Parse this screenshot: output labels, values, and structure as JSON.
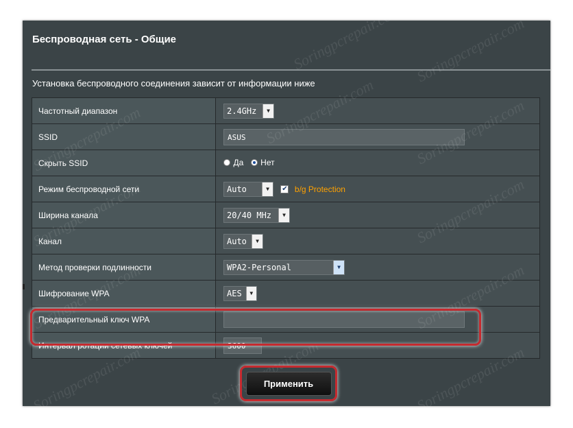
{
  "page": {
    "title": "Беспроводная сеть - Общие",
    "description": "Установка беспроводного соединения зависит от информации ниже"
  },
  "rows": {
    "band": {
      "label": "Частотный диапазон",
      "value": "2.4GHz"
    },
    "ssid": {
      "label": "SSID",
      "value": "ASUS"
    },
    "hide_ssid": {
      "label": "Скрыть SSID",
      "option_yes": "Да",
      "option_no": "Нет",
      "selected": "Нет"
    },
    "mode": {
      "label": "Режим беспроводной сети",
      "value": "Auto",
      "protection_label": "b/g Protection",
      "protection_checked": true
    },
    "width": {
      "label": "Ширина канала",
      "value": "20/40 MHz"
    },
    "channel": {
      "label": "Канал",
      "value": "Auto"
    },
    "auth": {
      "label": "Метод проверки подлинности",
      "value": "WPA2-Personal"
    },
    "encryption": {
      "label": "Шифрование WPA",
      "value": "AES"
    },
    "psk": {
      "label": "Предварительный ключ WPA",
      "value": ""
    },
    "rotation": {
      "label": "Интервал ротации сетевых ключей",
      "value": "3600"
    }
  },
  "apply_button": "Применить",
  "watermark": "Soringpcrepair.com",
  "colors": {
    "panel_bg": "#3b4447",
    "label_cell": "#4b575a",
    "value_cell": "#454f52",
    "highlight": "#c62a2f",
    "protection_text": "#ffa200"
  }
}
